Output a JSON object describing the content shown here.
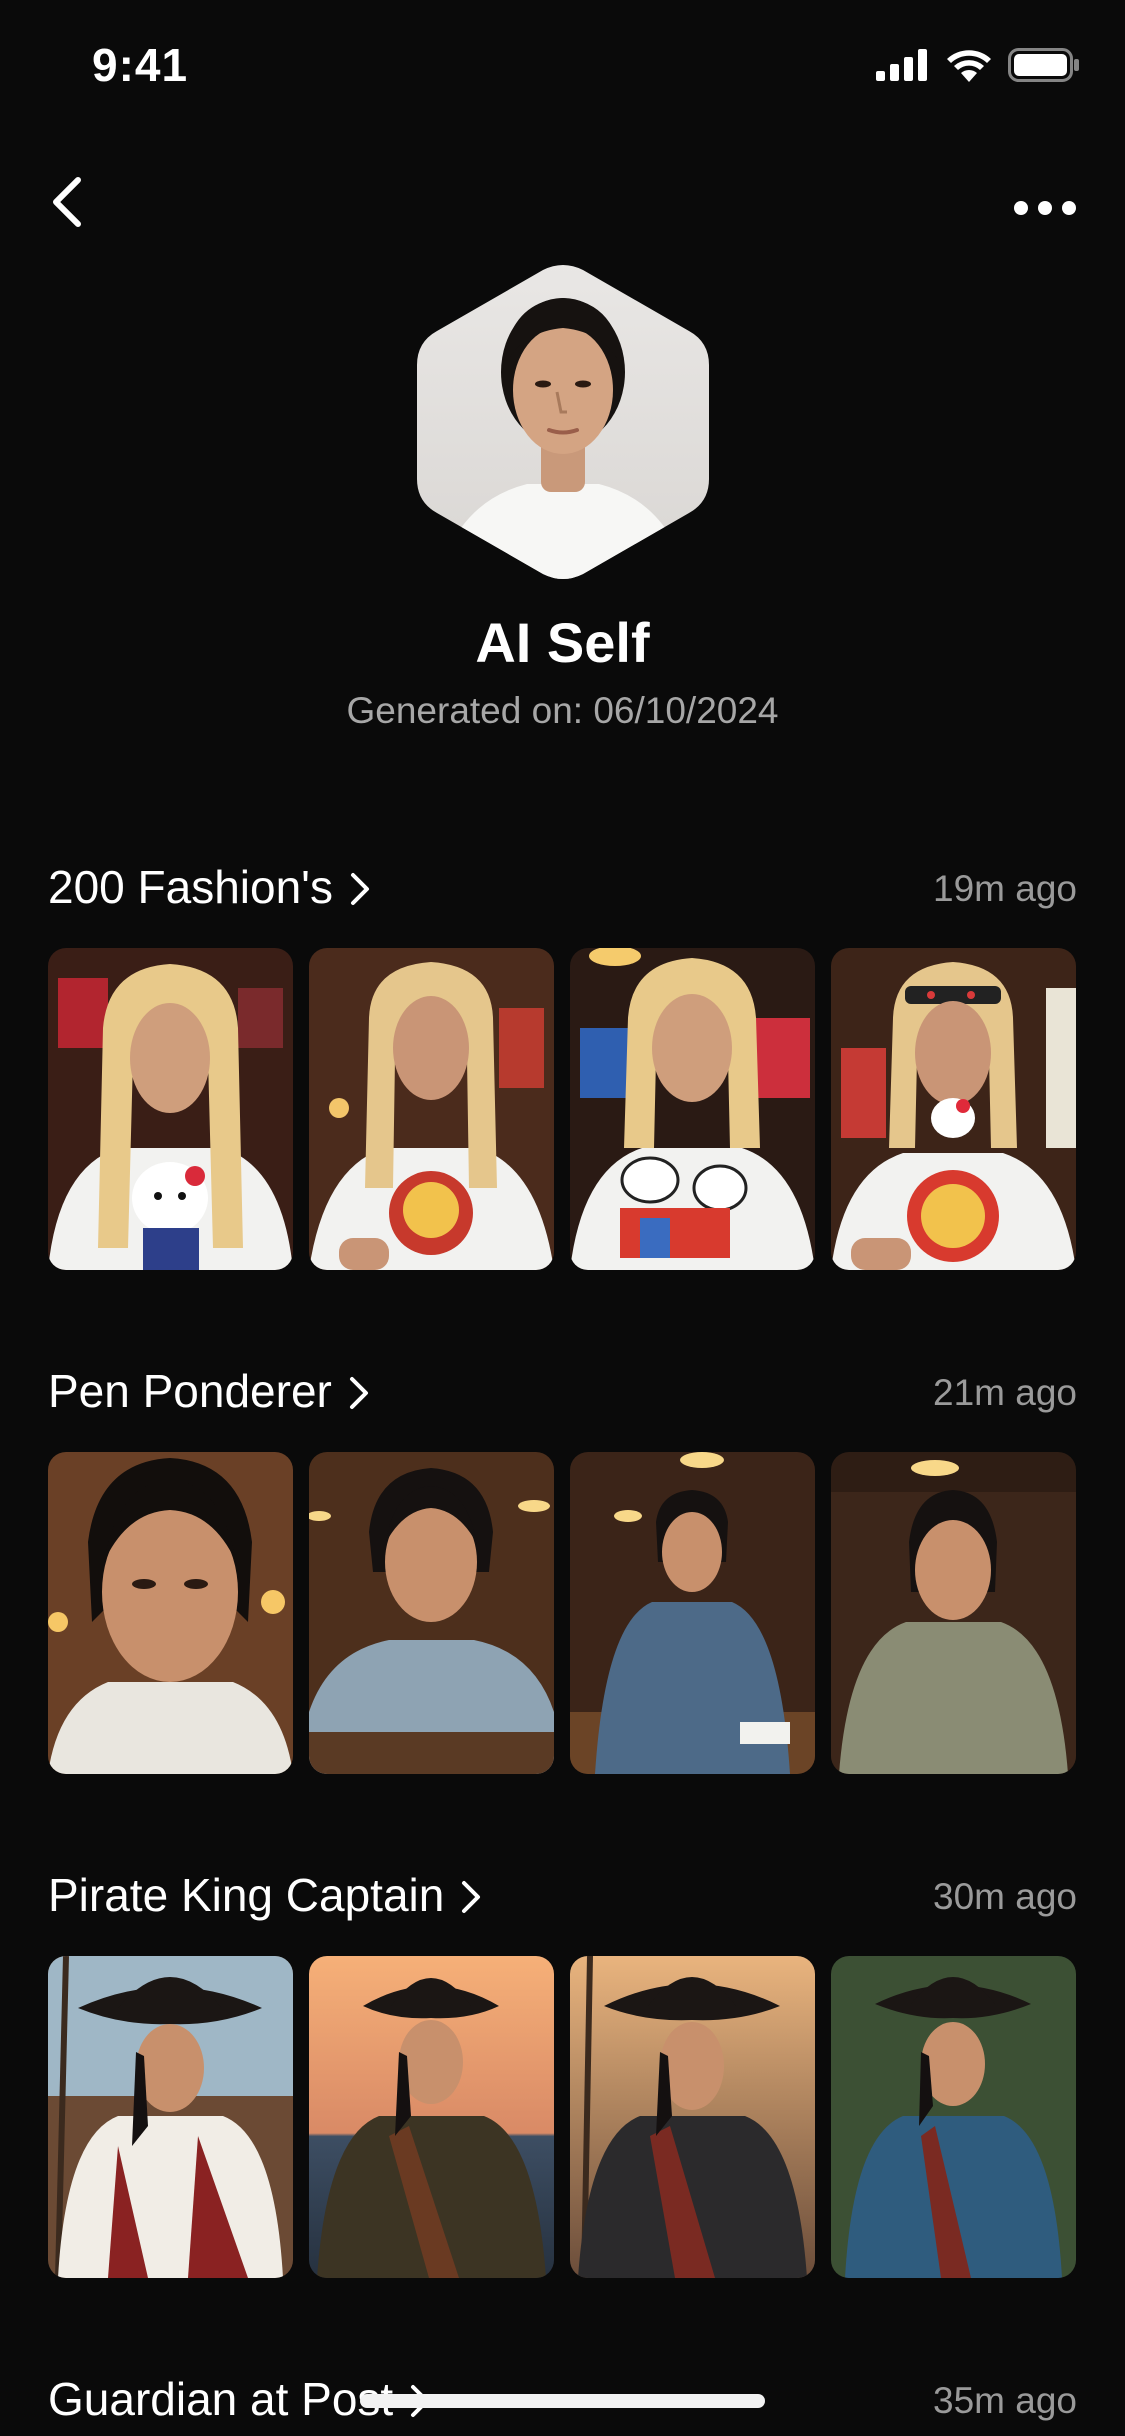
{
  "status_bar": {
    "time": "9:41"
  },
  "profile": {
    "title": "AI Self",
    "subtitle": "Generated on: 06/10/2024"
  },
  "sections": [
    {
      "title": "200 Fashion's",
      "time": "19m ago",
      "theme": "fashion"
    },
    {
      "title": "Pen Ponderer",
      "time": "21m ago",
      "theme": "office"
    },
    {
      "title": "Pirate King Captain",
      "time": "30m ago",
      "theme": "pirate"
    },
    {
      "title": "Guardian at Post",
      "time": "35m ago",
      "theme": "guardian"
    }
  ],
  "colors": {
    "background": "#0a0a0a",
    "text_primary": "#ffffff",
    "text_secondary": "#a7a7a7"
  }
}
